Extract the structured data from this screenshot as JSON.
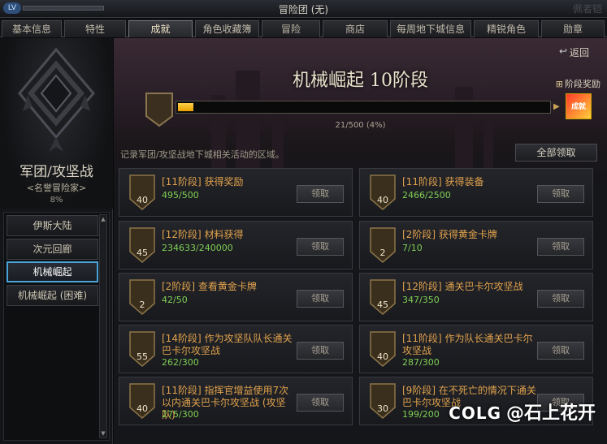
{
  "window": {
    "title": "冒险团 (无)",
    "level_badge": "LV",
    "ghost_text": "佩者铠"
  },
  "tabs": [
    {
      "label": "基本信息"
    },
    {
      "label": "特性"
    },
    {
      "label": "成就"
    },
    {
      "label": "角色收藏簿"
    },
    {
      "label": "冒险"
    },
    {
      "label": "商店"
    },
    {
      "label": "每周地下城信息"
    },
    {
      "label": "精锐角色"
    },
    {
      "label": "勋章"
    }
  ],
  "active_tab": "成就",
  "left": {
    "title": "军团/攻坚战",
    "subtitle": "<名誉冒险家>",
    "percent": "8%",
    "items": [
      {
        "label": "伊斯大陆"
      },
      {
        "label": "次元回廊"
      },
      {
        "label": "机械崛起"
      },
      {
        "label": "机械崛起 (困难)"
      }
    ],
    "active_item": "机械崛起"
  },
  "main": {
    "back_label": "返回",
    "stage_title": "机械崛起 10阶段",
    "stage_reward_label": "阶段奖励",
    "reward_box_label": "成就",
    "progress_text": "21/500 (4%)",
    "progress_fraction": 0.042,
    "description": "记录军团/攻坚战地下城相关活动的区域。",
    "claim_all_label": "全部领取"
  },
  "achievements": [
    {
      "level": "40",
      "name": "[11阶段] 获得奖励",
      "progress": "495/500",
      "button": "领取"
    },
    {
      "level": "40",
      "name": "[11阶段] 获得装备",
      "progress": "2466/2500",
      "button": "领取"
    },
    {
      "level": "45",
      "name": "[12阶段] 材料获得",
      "progress": "234633/240000",
      "button": "领取"
    },
    {
      "level": "2",
      "name": "[2阶段] 获得黄金卡牌",
      "progress": "7/10",
      "button": "领取"
    },
    {
      "level": "2",
      "name": "[2阶段] 查看黄金卡牌",
      "progress": "42/50",
      "button": "领取"
    },
    {
      "level": "45",
      "name": "[12阶段] 通关巴卡尔攻坚战",
      "progress": "347/350",
      "button": "领取"
    },
    {
      "level": "55",
      "name": "[14阶段] 作为攻坚队队长通关巴卡尔攻坚战",
      "progress": "262/300",
      "button": "领取"
    },
    {
      "level": "40",
      "name": "[11阶段] 作为队长通关巴卡尔攻坚战",
      "progress": "287/300",
      "button": "领取"
    },
    {
      "level": "40",
      "name": "[11阶段] 指挥官增益使用7次以内通关巴卡尔攻坚战 (攻坚队)",
      "progress": "275/300",
      "button": "领取"
    },
    {
      "level": "30",
      "name": "[9阶段] 在不死亡的情况下通关巴卡尔攻坚战",
      "progress": "199/200",
      "button": "领取"
    }
  ],
  "watermark": {
    "logo": "COLG",
    "text": "@石上花开"
  },
  "colors": {
    "accent_gold": "#e0a24c",
    "progress_green": "#7fcf54",
    "active_blue": "#4aa3d8",
    "bar_yellow": "#ffd24a"
  }
}
